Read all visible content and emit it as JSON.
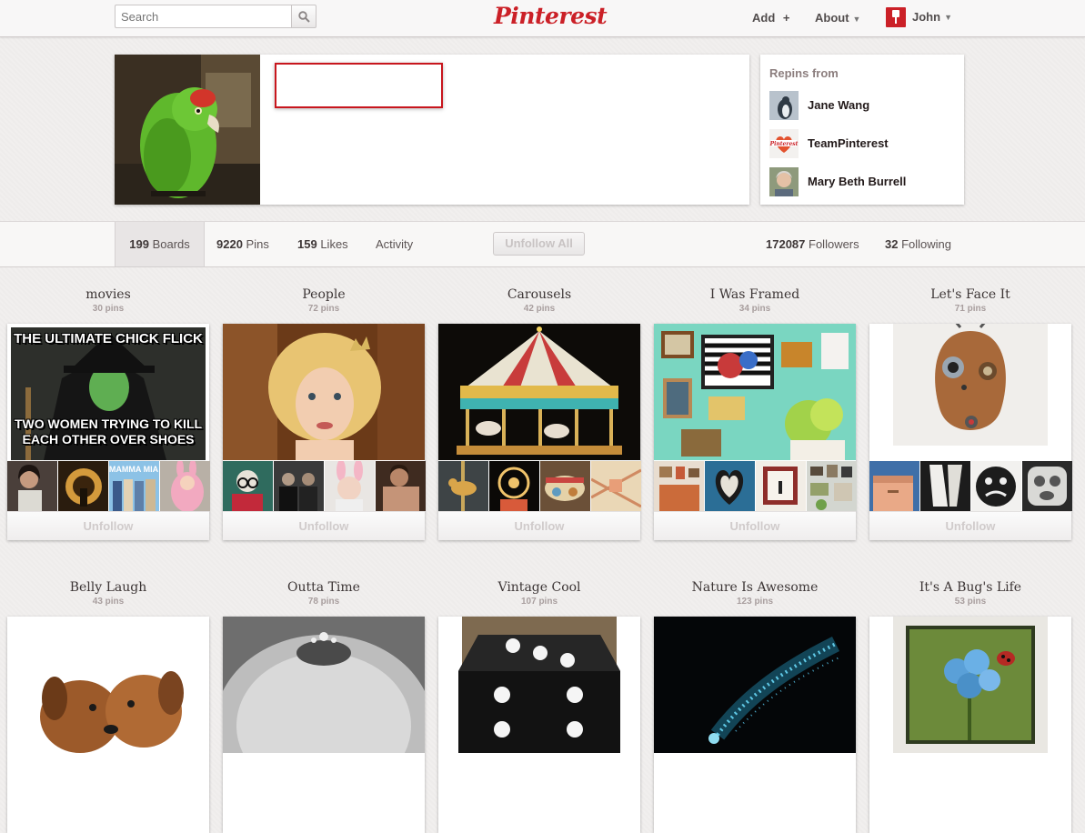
{
  "header": {
    "search_placeholder": "Search",
    "logo": "Pinterest",
    "nav": {
      "add": "Add",
      "add_icon": "plus-icon",
      "about": "About",
      "user": "John"
    }
  },
  "repins": {
    "title": "Repins from",
    "items": [
      {
        "name": "Jane Wang"
      },
      {
        "name": "TeamPinterest"
      },
      {
        "name": "Mary Beth Burrell"
      }
    ]
  },
  "stats": {
    "boards_count": "199",
    "boards_label": "Boards",
    "pins_count": "9220",
    "pins_label": "Pins",
    "likes_count": "159",
    "likes_label": "Likes",
    "activity_label": "Activity",
    "unfollow_all": "Unfollow All",
    "followers_count": "172087",
    "followers_label": "Followers",
    "following_count": "32",
    "following_label": "Following"
  },
  "boards": [
    {
      "title": "movies",
      "count": "30 pins",
      "unfollow": "Unfollow",
      "cover_text_top": "THE ULTIMATE CHICK FLICK",
      "cover_text_bottom": "TWO WOMEN TRYING TO KILL EACH OTHER OVER SHOES",
      "thumb_text": "MAMMA MIA"
    },
    {
      "title": "People",
      "count": "72 pins",
      "unfollow": "Unfollow"
    },
    {
      "title": "Carousels",
      "count": "42 pins",
      "unfollow": "Unfollow"
    },
    {
      "title": "I Was Framed",
      "count": "34 pins",
      "unfollow": "Unfollow"
    },
    {
      "title": "Let's Face It",
      "count": "71 pins",
      "unfollow": "Unfollow"
    },
    {
      "title": "Belly Laugh",
      "count": "43 pins"
    },
    {
      "title": "Outta Time",
      "count": "78 pins"
    },
    {
      "title": "Vintage Cool",
      "count": "107 pins"
    },
    {
      "title": "Nature Is Awesome",
      "count": "123 pins"
    },
    {
      "title": "It's A Bug's Life",
      "count": "53 pins"
    }
  ],
  "colors": {
    "brand": "#cb2027",
    "name_box_border": "#c8161d"
  }
}
